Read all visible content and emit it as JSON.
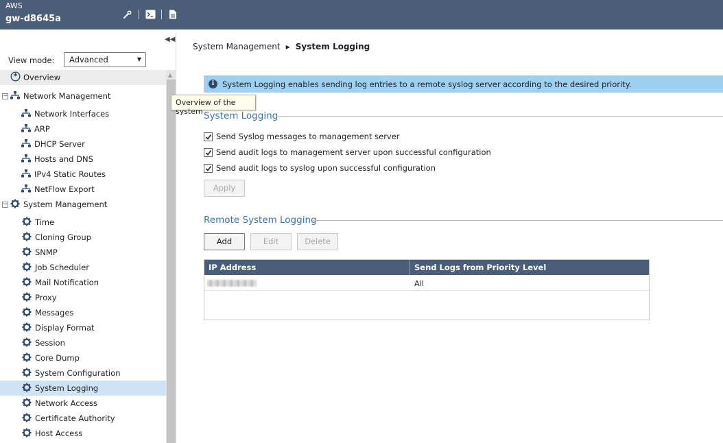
{
  "header": {
    "cloud": "AWS",
    "gateway": "gw-d8645a",
    "tools": [
      "wrench-icon",
      "terminal-icon",
      "document-icon"
    ]
  },
  "sidebar": {
    "view_mode_label": "View mode:",
    "view_mode_value": "Advanced",
    "overview_label": "Overview",
    "network_group": "Network Management",
    "network_items": [
      "Network Interfaces",
      "ARP",
      "DHCP Server",
      "Hosts and DNS",
      "IPv4 Static Routes",
      "NetFlow Export"
    ],
    "system_group": "System Management",
    "system_items": [
      "Time",
      "Cloning Group",
      "SNMP",
      "Job Scheduler",
      "Mail Notification",
      "Proxy",
      "Messages",
      "Display Format",
      "Session",
      "Core Dump",
      "System Configuration",
      "System Logging",
      "Network Access",
      "Certificate Authority",
      "Host Access"
    ],
    "selected": "System Logging"
  },
  "tooltip": "Overview of the system",
  "breadcrumb": {
    "parent": "System Management",
    "current": "System Logging"
  },
  "info": "System Logging enables sending log entries to a remote syslog server according to the desired priority.",
  "system_logging": {
    "title": "System Logging",
    "options": [
      {
        "label": "Send Syslog messages to management server",
        "checked": true
      },
      {
        "label": "Send audit logs to management server upon successful configuration",
        "checked": true
      },
      {
        "label": "Send audit logs to syslog upon successful configuration",
        "checked": true
      }
    ],
    "apply_label": "Apply"
  },
  "remote_logging": {
    "title": "Remote System Logging",
    "add_label": "Add",
    "edit_label": "Edit",
    "delete_label": "Delete",
    "columns": [
      "IP Address",
      "Send Logs from Priority Level"
    ],
    "rows": [
      {
        "ip": "",
        "priority": "All"
      }
    ]
  },
  "colors": {
    "topbar": "#4a5e79",
    "info_bg": "#9ed1f1",
    "section_title": "#3b73b0",
    "selected_bg": "#cfe3f7"
  }
}
